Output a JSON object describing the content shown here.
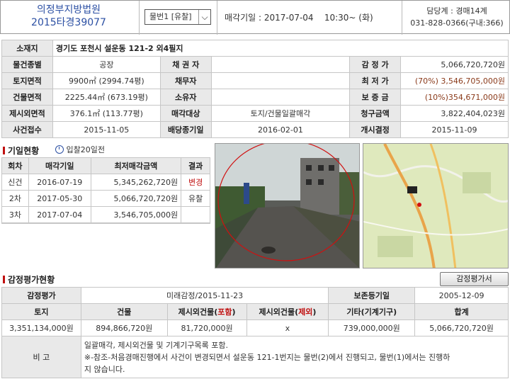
{
  "header": {
    "court": "의정부지방법원",
    "case_no": "2015타경39077",
    "item_select": "물번1 [유찰]",
    "auction_date_label": "매각기일 : 2017-07-04",
    "auction_time": "10:30~ (화)",
    "dept": "담당계 : 경매14계",
    "phone": "031-828-0366(구내:366)"
  },
  "info": {
    "address_label": "소재지",
    "address": "경기도 포천시 설운동 121-2 외4필지",
    "rows": [
      {
        "l1": "물건종별",
        "v1": "공장",
        "l2": "채 권 자",
        "v2": "",
        "l3": "감 정 가",
        "v3": "5,066,720,720원"
      },
      {
        "l1": "토지면적",
        "v1": "9900㎡ (2994.74평)",
        "l2": "채무자",
        "v2": "",
        "l3": "최 저 가",
        "v3": "(70%) 3,546,705,000원"
      },
      {
        "l1": "건물면적",
        "v1": "2225.44㎡ (673.19평)",
        "l2": "소유자",
        "v2": "",
        "l3": "보 증 금",
        "v3": "(10%)354,671,000원"
      },
      {
        "l1": "제시외면적",
        "v1": "376.1㎡ (113.77평)",
        "l2": "매각대상",
        "v2": "토지/건물일괄매각",
        "l3": "청구금액",
        "v3": "3,822,404,023원"
      },
      {
        "l1": "사건접수",
        "v1": "2015-11-05",
        "l2": "배당종기일",
        "v2": "2016-02-01",
        "l3": "개시결정",
        "v3": "2015-11-09"
      }
    ]
  },
  "history": {
    "title": "기일현황",
    "days_label": "입찰20일전",
    "headers": [
      "회차",
      "매각기일",
      "최저매각금액",
      "결과"
    ],
    "rows": [
      {
        "round": "신건",
        "date": "2016-07-19",
        "amount": "5,345,262,720원",
        "result": "변경"
      },
      {
        "round": "2차",
        "date": "2017-05-30",
        "amount": "5,066,720,720원",
        "result": "유찰"
      },
      {
        "round": "3차",
        "date": "2017-07-04",
        "amount": "3,546,705,000원",
        "result": ""
      }
    ]
  },
  "appraisal": {
    "title": "감정평가현황",
    "button": "감정평가서",
    "label_eval": "감정평가",
    "eval_value": "미래감정/2015-11-23",
    "label_preserve": "보존등기일",
    "preserve_value": "2005-12-09",
    "headers": {
      "land": "토지",
      "building": "건물",
      "extra_incl_a": "제시외건물(",
      "extra_incl_b": "포함",
      "extra_excl_a": "제시외건물(",
      "extra_excl_b": "제외",
      "close": ")",
      "etc": "기타(기계기구)",
      "total": "합계"
    },
    "values": {
      "land": "3,351,134,000원",
      "building": "894,866,720원",
      "extra_incl": "81,720,000원",
      "extra_excl": "x",
      "etc": "739,000,000원",
      "total": "5,066,720,720원"
    },
    "note_label": "비 고",
    "note_lines": [
      "일괄매각, 제시외건물 및 기계기구목록 포함.",
      "※-참조-처음경매진행에서 사건이 변경되면서 설운동 121-1번지는 물번(2)에서 진행되고, 물번(1)에서는 진행하",
      "지 않습니다."
    ]
  },
  "colors": {
    "accent_blue": "#2b4fa3",
    "red": "#c01010"
  }
}
